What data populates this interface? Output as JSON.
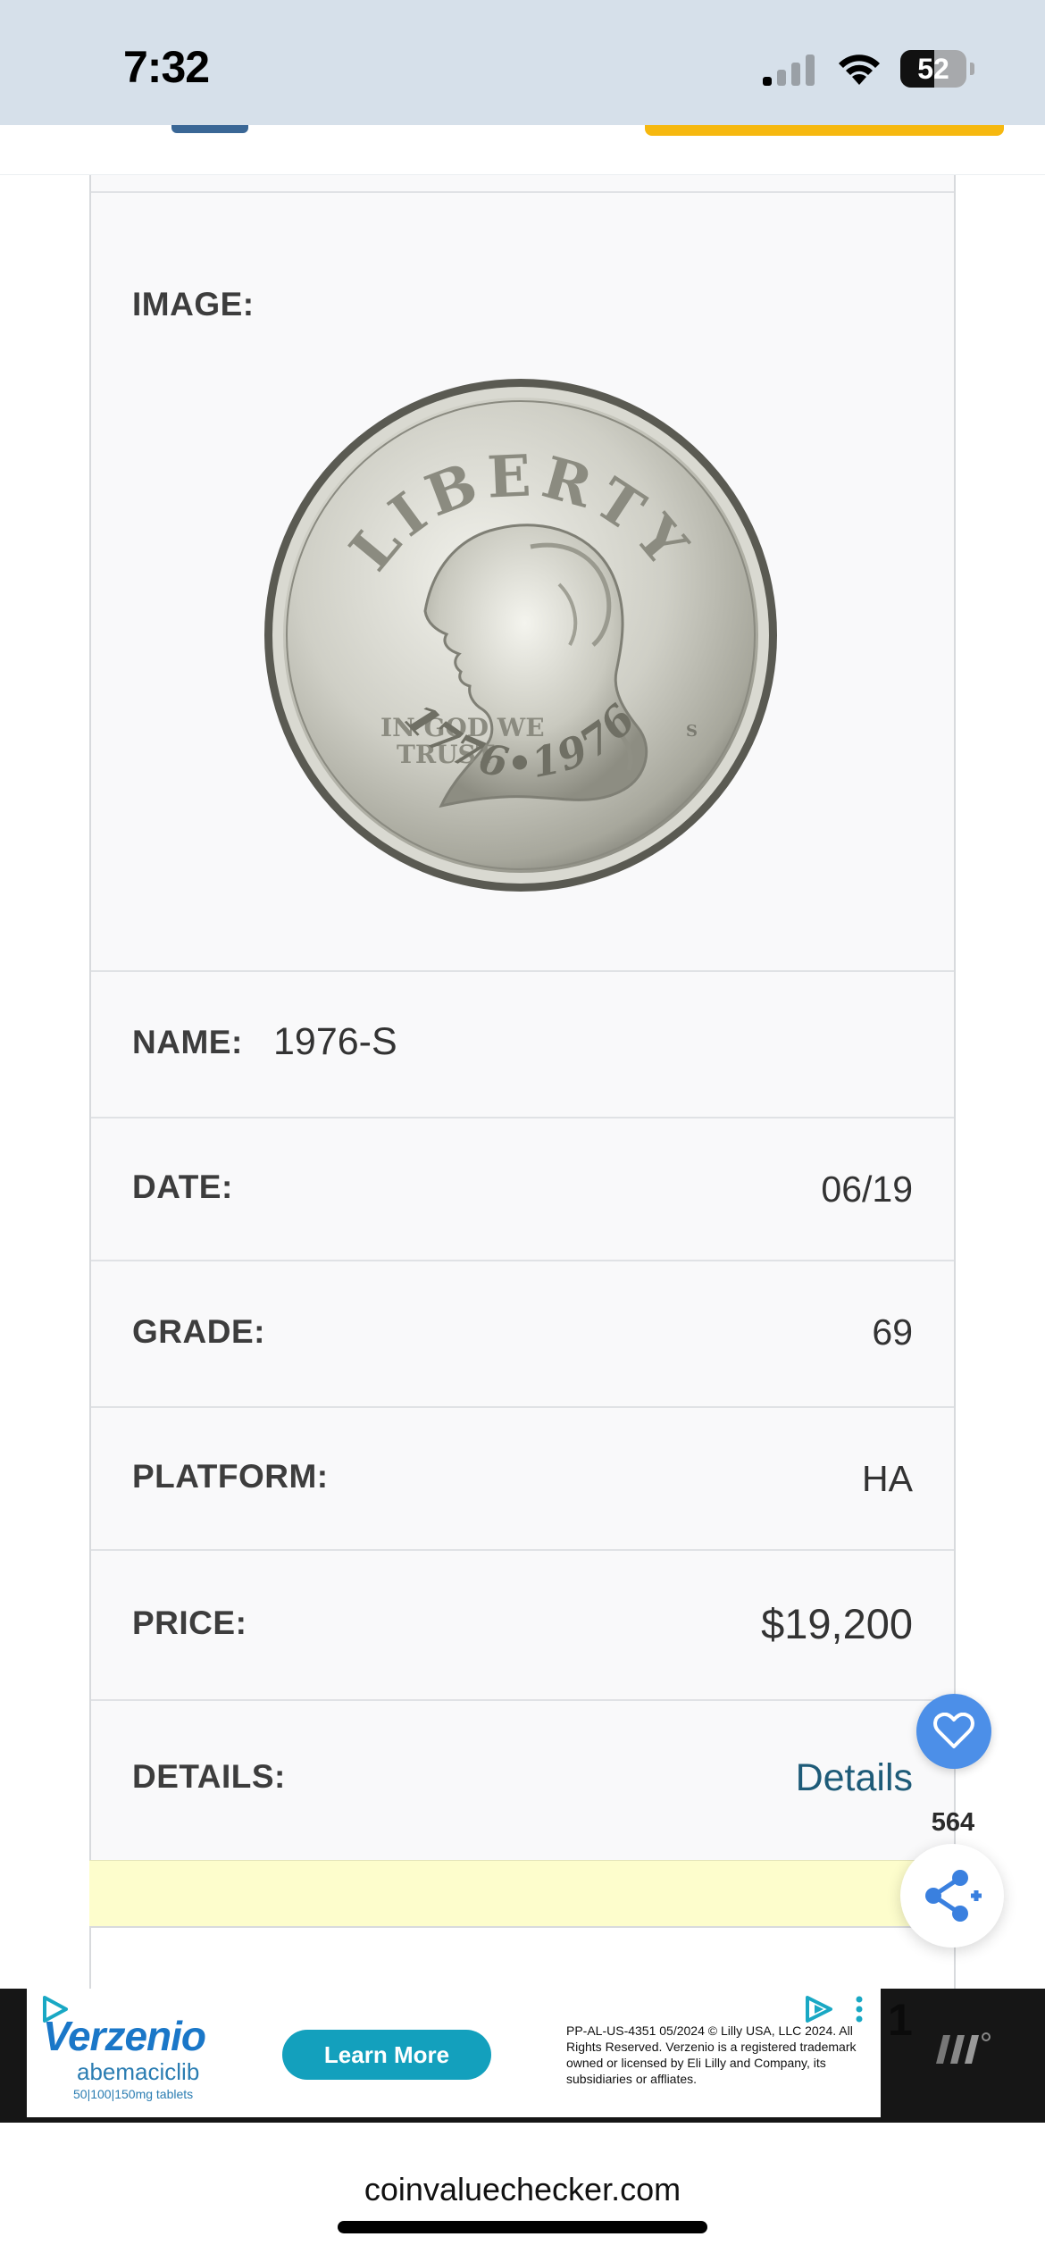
{
  "status_bar": {
    "time": "7:32",
    "battery": "52",
    "battery_level": 0.52
  },
  "table": {
    "image_label": "IMAGE:",
    "coin": {
      "top_legend": "LIBERTY",
      "motto_line1": "IN GOD WE",
      "motto_line2": "TRUST",
      "date": "1776•1976",
      "mint_mark": "S"
    },
    "name_label": "NAME:",
    "name_value": "1976-S",
    "date_label": "DATE:",
    "date_value": "06/19",
    "grade_label": "GRADE:",
    "grade_value": "69",
    "platform_label": "PLATFORM:",
    "platform_value": "HA",
    "price_label": "PRICE:",
    "price_value": "$19,200",
    "details_label": "DETAILS:",
    "details_link": "Details"
  },
  "floating": {
    "like_count": "564",
    "icons": [
      "heart-icon",
      "share-icon"
    ]
  },
  "ad": {
    "brand": "Verzenio",
    "generic": "abemaciclib",
    "dose": "50|100|150mg tablets",
    "cta": "Learn More",
    "legal": "PP-AL-US-4351 05/2024 © Lilly USA, LLC 2024. All Rights Reserved. Verzenio is a registered trademark owned or licensed by Eli Lilly and Company, its subsidiaries or affliates.",
    "digit": "1"
  },
  "browser": {
    "url": "coinvaluechecker.com"
  },
  "colors": {
    "status_bg": "#d6e0ea",
    "accent_blue": "#4c8fe8",
    "link": "#1e5b78",
    "note_yellow": "#fdfdcc",
    "ad_teal": "#13a0bd"
  }
}
